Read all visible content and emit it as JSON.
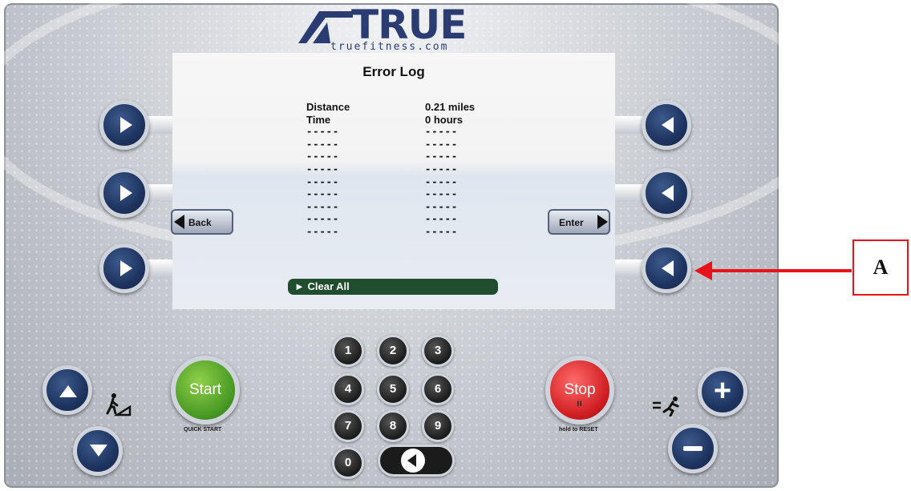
{
  "logo": {
    "brand": "TRUE",
    "url_text": "truefitness.com"
  },
  "screen": {
    "title": "Error Log",
    "rows": [
      {
        "label": "Distance",
        "value": "0.21 miles"
      },
      {
        "label": "Time",
        "value": "0 hours"
      },
      {
        "label": "-----",
        "value": "-----"
      },
      {
        "label": "-----",
        "value": "-----"
      },
      {
        "label": "-----",
        "value": "-----"
      },
      {
        "label": "-----",
        "value": "-----"
      },
      {
        "label": "-----",
        "value": "-----"
      },
      {
        "label": "-----",
        "value": "-----"
      },
      {
        "label": "-----",
        "value": "-----"
      },
      {
        "label": "-----",
        "value": "-----"
      },
      {
        "label": "-----",
        "value": "-----"
      }
    ],
    "clear_all": "► Clear All",
    "back_label": "Back",
    "enter_label": "Enter"
  },
  "controls": {
    "start_label": "Start",
    "start_sub": "QUICK START",
    "stop_label": "Stop",
    "stop_pause": "II",
    "stop_sub": "hold to RESET",
    "keypad": [
      "1",
      "2",
      "3",
      "4",
      "5",
      "6",
      "7",
      "8",
      "9",
      "0"
    ]
  },
  "icons": {
    "incline": "incline-icon",
    "speed": "runner-speed-icon"
  },
  "callout": {
    "label": "A",
    "color": "#e8121b"
  }
}
